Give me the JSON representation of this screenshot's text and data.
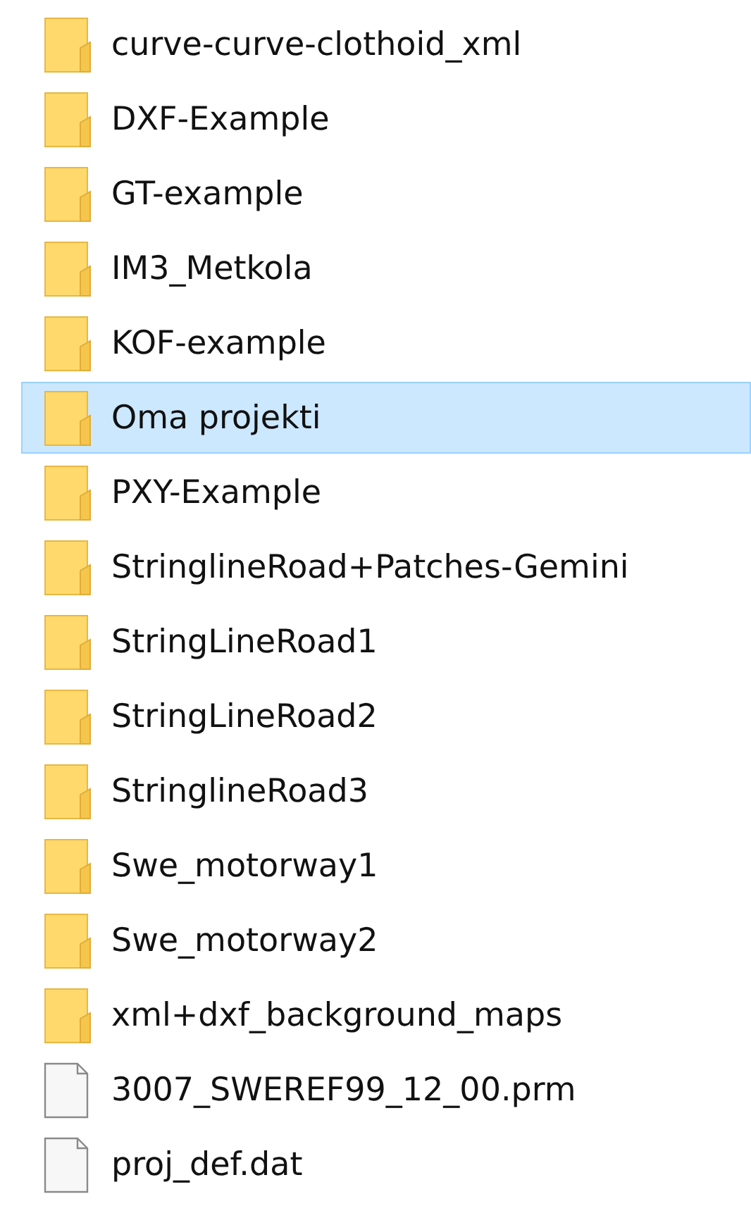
{
  "items": [
    {
      "kind": "folder",
      "name": "curve-curve-clothoid_xml",
      "selected": false
    },
    {
      "kind": "folder",
      "name": "DXF-Example",
      "selected": false
    },
    {
      "kind": "folder",
      "name": "GT-example",
      "selected": false
    },
    {
      "kind": "folder",
      "name": "IM3_Metkola",
      "selected": false
    },
    {
      "kind": "folder",
      "name": "KOF-example",
      "selected": false
    },
    {
      "kind": "folder",
      "name": "Oma projekti",
      "selected": true
    },
    {
      "kind": "folder",
      "name": "PXY-Example",
      "selected": false
    },
    {
      "kind": "folder",
      "name": "StringlineRoad+Patches-Gemini",
      "selected": false
    },
    {
      "kind": "folder",
      "name": "StringLineRoad1",
      "selected": false
    },
    {
      "kind": "folder",
      "name": "StringLineRoad2",
      "selected": false
    },
    {
      "kind": "folder",
      "name": "StringlineRoad3",
      "selected": false
    },
    {
      "kind": "folder",
      "name": "Swe_motorway1",
      "selected": false
    },
    {
      "kind": "folder",
      "name": "Swe_motorway2",
      "selected": false
    },
    {
      "kind": "folder",
      "name": "xml+dxf_background_maps",
      "selected": false
    },
    {
      "kind": "file",
      "name": "3007_SWEREF99_12_00.prm",
      "selected": false
    },
    {
      "kind": "file",
      "name": "proj_def.dat",
      "selected": false
    }
  ]
}
